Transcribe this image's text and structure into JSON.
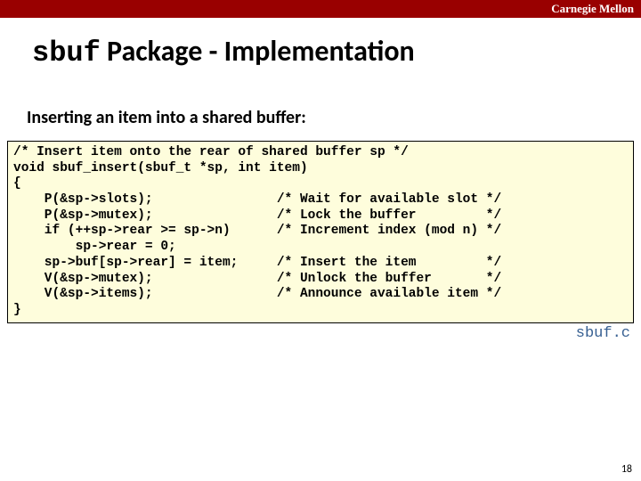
{
  "header": {
    "university": "Carnegie Mellon"
  },
  "title": {
    "code": "sbuf",
    "rest": " Package - Implementation"
  },
  "subhead": "Inserting an item into a shared buffer:",
  "code": "/* Insert item onto the rear of shared buffer sp */\nvoid sbuf_insert(sbuf_t *sp, int item)\n{\n    P(&sp->slots);                /* Wait for available slot */\n    P(&sp->mutex);                /* Lock the buffer         */\n    if (++sp->rear >= sp->n)      /* Increment index (mod n) */\n        sp->rear = 0;\n    sp->buf[sp->rear] = item;     /* Insert the item         */\n    V(&sp->mutex);                /* Unlock the buffer       */\n    V(&sp->items);                /* Announce available item */\n}",
  "filename": "sbuf.c",
  "page": "18"
}
